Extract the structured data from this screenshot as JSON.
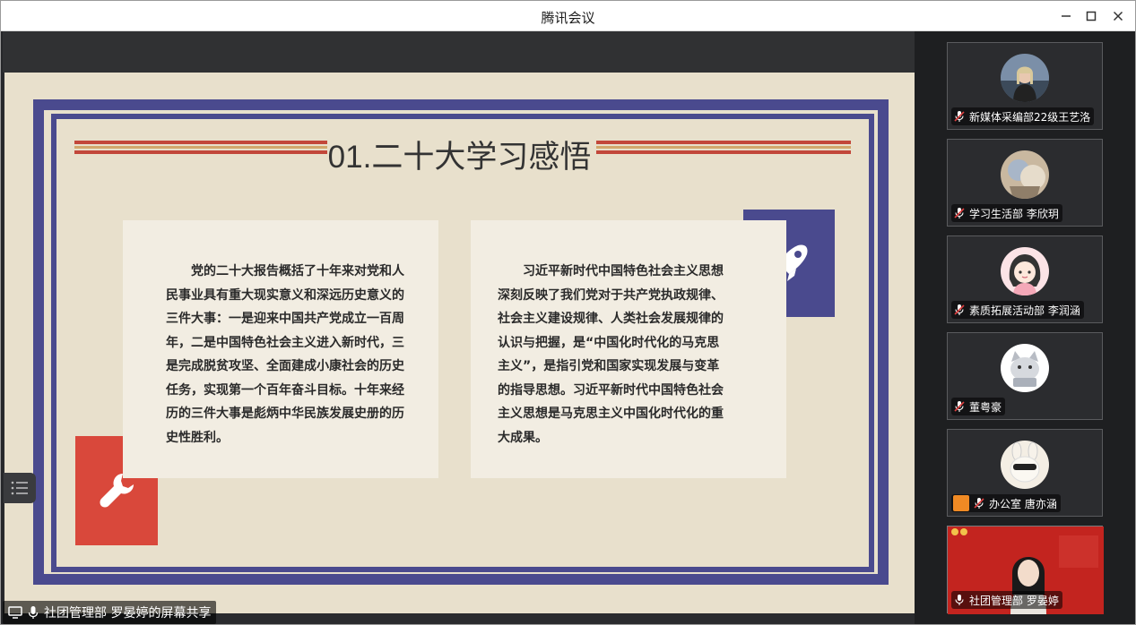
{
  "window": {
    "title": "腾讯会议"
  },
  "slide": {
    "title": "01.二十大学习感悟",
    "left_text": "党的二十大报告概括了十年来对党和人民事业具有重大现实意义和深远历史意义的三件大事：一是迎来中国共产党成立一百周年，二是中国特色社会主义进入新时代，三是完成脱贫攻坚、全面建成小康社会的历史任务，实现第一个百年奋斗目标。十年来经历的三件大事是彪炳中华民族发展史册的历史性胜利。",
    "right_text": "习近平新时代中国特色社会主义思想深刻反映了我们党对于共产党执政规律、社会主义建设规律、人类社会发展规律的认识与把握，是“中国化时代化的马克思主义”，是指引党和国家实现发展与变革的指导思想。习近平新时代中国特色社会主义思想是马克思主义中国化时代化的重大成果。",
    "colors": {
      "frame": "#4a4a8e",
      "rule": "#c2473a",
      "rule_accent": "#d2a86c",
      "deco_red": "#d9483b",
      "deco_blue": "#4a4a8e",
      "background": "#e8e0cc"
    },
    "icons": [
      "rocket-icon",
      "wrench-icon"
    ]
  },
  "presenter": {
    "label": "社团管理部 罗晏婷的屏幕共享"
  },
  "participants": [
    {
      "name": "新媒体采编部22级王艺洛",
      "avatar": "photo"
    },
    {
      "name": "学习生活部 李欣玥",
      "avatar": "photo"
    },
    {
      "name": "素质拓展活动部 李润涵",
      "avatar": "cartoon-girl"
    },
    {
      "name": "董粤豪",
      "avatar": "cartoon-cat"
    },
    {
      "name": "办公室 唐亦涵",
      "avatar": "cartoon-bunny"
    },
    {
      "name": "社团管理部 罗晏婷",
      "avatar": "video"
    }
  ],
  "controls": {
    "minimize": "–",
    "maximize": "☐",
    "close": "✕"
  }
}
